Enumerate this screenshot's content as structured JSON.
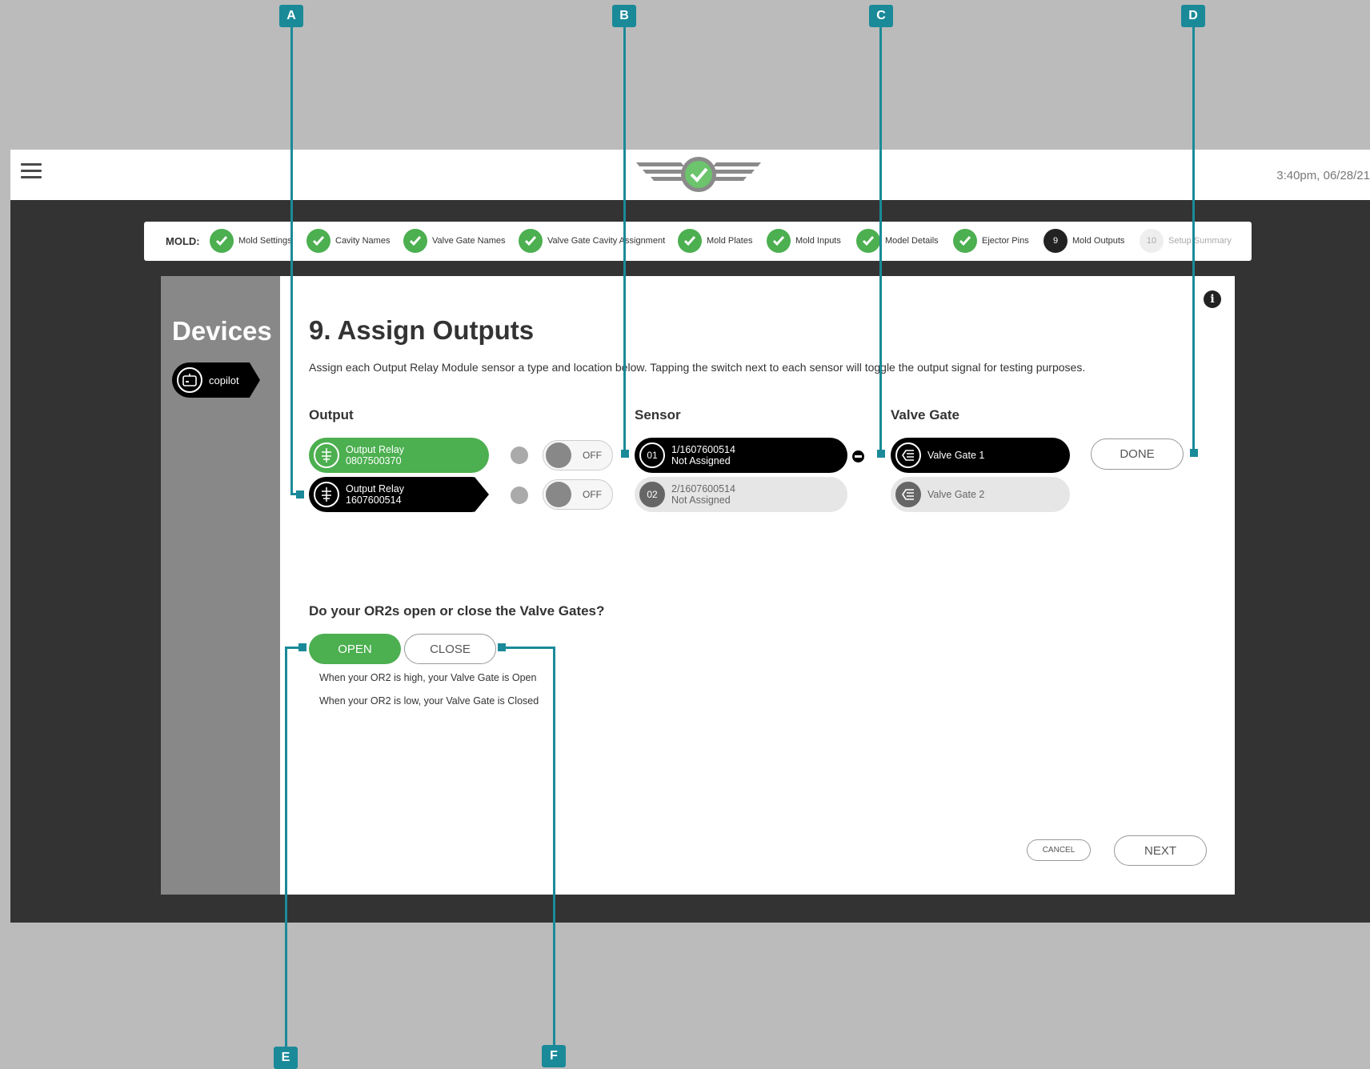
{
  "header": {
    "timestamp": "3:40pm, 06/28/21"
  },
  "stepper": {
    "label": "MOLD:",
    "steps": [
      {
        "label": "Mold Settings",
        "state": "done"
      },
      {
        "label": "Cavity Names",
        "state": "done"
      },
      {
        "label": "Valve Gate Names",
        "state": "done"
      },
      {
        "label": "Valve Gate Cavity Assignment",
        "state": "done"
      },
      {
        "label": "Mold Plates",
        "state": "done"
      },
      {
        "label": "Mold Inputs",
        "state": "done"
      },
      {
        "label": "Model Details",
        "state": "done"
      },
      {
        "label": "Ejector Pins",
        "state": "done"
      },
      {
        "num": "9",
        "label": "Mold Outputs",
        "state": "current"
      },
      {
        "num": "10",
        "label": "Setup Summary",
        "state": "pending"
      }
    ]
  },
  "sidebar": {
    "title": "Devices",
    "device": "copilot"
  },
  "main": {
    "title": "9. Assign Outputs",
    "description": "Assign each Output Relay Module sensor a type and location below. Tapping the switch next to each sensor will toggle the output signal for testing purposes.",
    "columns": {
      "output": "Output",
      "sensor": "Sensor",
      "valve_gate": "Valve Gate"
    },
    "outputs": [
      {
        "name": "Output Relay",
        "serial": "0807500370",
        "toggle": "OFF"
      },
      {
        "name": "Output Relay",
        "serial": "1607600514",
        "toggle": "OFF"
      }
    ],
    "sensors": [
      {
        "num": "01",
        "id": "1/1607600514",
        "status": "Not Assigned"
      },
      {
        "num": "02",
        "id": "2/1607600514",
        "status": "Not Assigned"
      }
    ],
    "valve_gates": [
      "Valve Gate 1",
      "Valve Gate 2"
    ],
    "done_label": "DONE",
    "question": "Do your OR2s open or close the Valve Gates?",
    "open_label": "OPEN",
    "close_label": "CLOSE",
    "hint_high": "When your OR2 is high, your Valve Gate is Open",
    "hint_low": "When your OR2 is low, your Valve Gate is Closed",
    "cancel_label": "CANCEL",
    "next_label": "NEXT"
  },
  "callouts": [
    "A",
    "B",
    "C",
    "D",
    "E",
    "F"
  ],
  "colors": {
    "accent_green": "#4caf50",
    "callout_teal": "#1a8a99",
    "dark_bg": "#333333"
  }
}
